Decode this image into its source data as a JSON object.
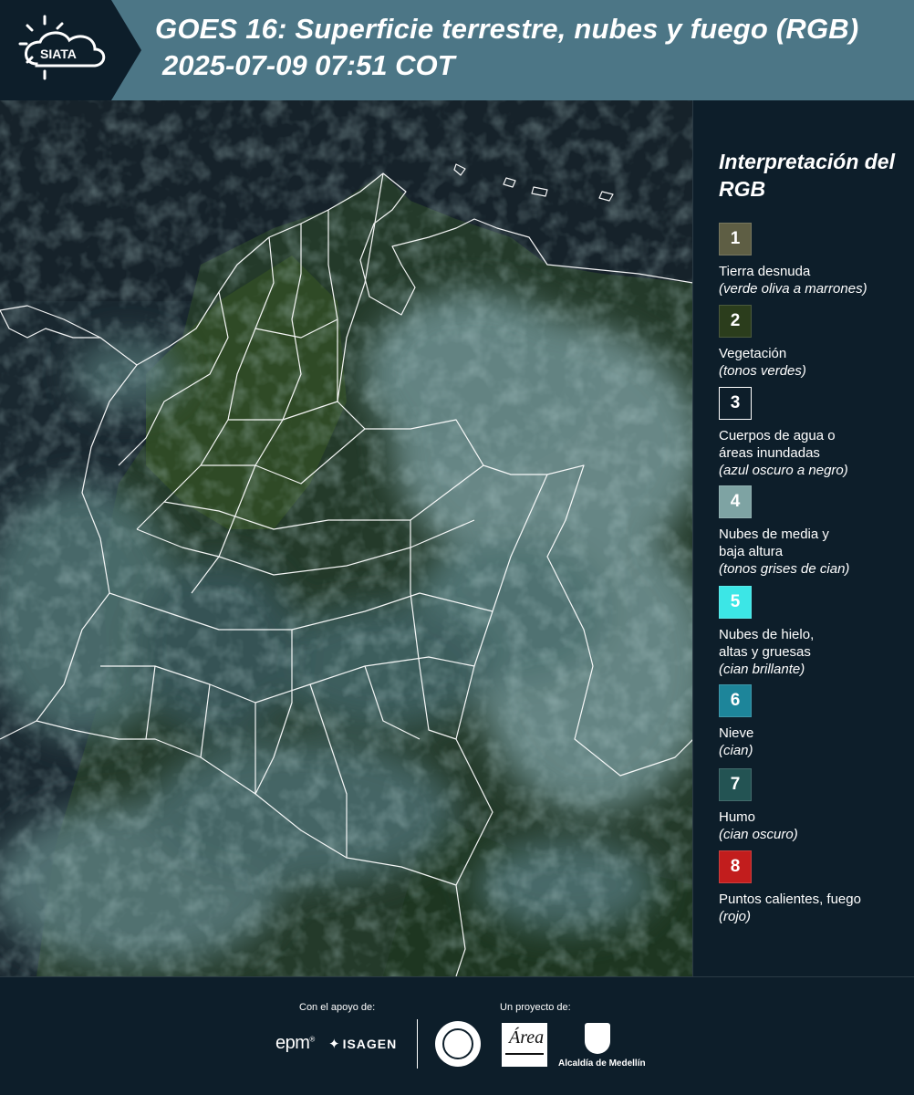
{
  "header": {
    "logo_text": "SIATA",
    "title_line1": "GOES 16: Superficie terrestre, nubes y fuego (RGB)",
    "title_line2": "2025-07-09 07:51 COT"
  },
  "legend": {
    "title": "Interpretación del RGB",
    "items": [
      {
        "number": "1",
        "color": "#5e5e44",
        "label": "Tierra desnuda",
        "note": "(verde oliva a marrones)"
      },
      {
        "number": "2",
        "color": "#2b3d1c",
        "label": "Vegetación",
        "note": "(tonos verdes)"
      },
      {
        "number": "3",
        "color": "#0d1e2a",
        "label": "Cuerpos de agua o\náreas inundadas",
        "note": "(azul oscuro a negro)"
      },
      {
        "number": "4",
        "color": "#7ea3a3",
        "label": "Nubes de media y\nbaja altura",
        "note": "(tonos grises de cian)"
      },
      {
        "number": "5",
        "color": "#3ce6e6",
        "label": "Nubes de hielo,\naltas y gruesas",
        "note": "(cian brillante)"
      },
      {
        "number": "6",
        "color": "#1d859a",
        "label": "Nieve",
        "note": "(cian)"
      },
      {
        "number": "7",
        "color": "#235353",
        "label": "Humo",
        "note": "(cian oscuro)"
      },
      {
        "number": "8",
        "color": "#c21d1d",
        "label": "Puntos calientes, fuego",
        "note": "(rojo)"
      }
    ]
  },
  "footer": {
    "support_label": "Con el apoyo de:",
    "project_label": "Un proyecto de:",
    "sponsors": [
      "epm",
      "ISAGEN"
    ],
    "partners": [
      "Área Metropolitana Valle de Aburrá",
      "Alcaldía de Medellín"
    ],
    "alcaldia_label": "Alcaldía de Medellín"
  }
}
